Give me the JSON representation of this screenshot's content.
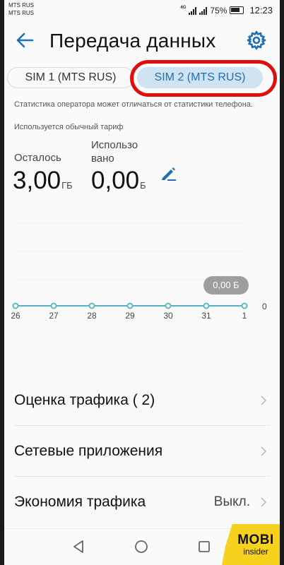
{
  "status_bar": {
    "carrier_1": "MTS RUS",
    "carrier_2": "MTS RUS",
    "network_type": "4G",
    "battery": "75%",
    "time": "12:23"
  },
  "header": {
    "title": "Передача данных"
  },
  "sim_tabs": [
    {
      "label": "SIM 1 (MTS RUS)",
      "active": false
    },
    {
      "label": "SIM 2 (MTS RUS)",
      "active": true
    }
  ],
  "notes": {
    "operator_stats": "Статистика оператора может отличаться от статистики телефона.",
    "plan": "Используется обычный тариф"
  },
  "stats": {
    "remaining_label": "Осталось",
    "remaining_value": "3,00",
    "remaining_unit": "ГБ",
    "used_label_line1": "Использо",
    "used_label_line2": "вано",
    "used_value": "0,00",
    "used_unit": "Б"
  },
  "chart_data": {
    "type": "line",
    "x": [
      "26",
      "27",
      "28",
      "29",
      "30",
      "31",
      "1"
    ],
    "values": [
      0,
      0,
      0,
      0,
      0,
      0,
      0
    ],
    "y_tick": "0",
    "tooltip": "0,00 Б",
    "line_color": "#4fb3c2"
  },
  "list": [
    {
      "label": "Оценка трафика ( 2)",
      "value": ""
    },
    {
      "label": "Сетевые приложения",
      "value": ""
    },
    {
      "label": "Экономия трафика",
      "value": "Выкл."
    }
  ],
  "watermark": {
    "main": "MOBI",
    "sub": "insider"
  },
  "colors": {
    "accent": "#1f6fb2",
    "highlight": "#e10d0d",
    "watermark_bg": "#f6d21e"
  }
}
